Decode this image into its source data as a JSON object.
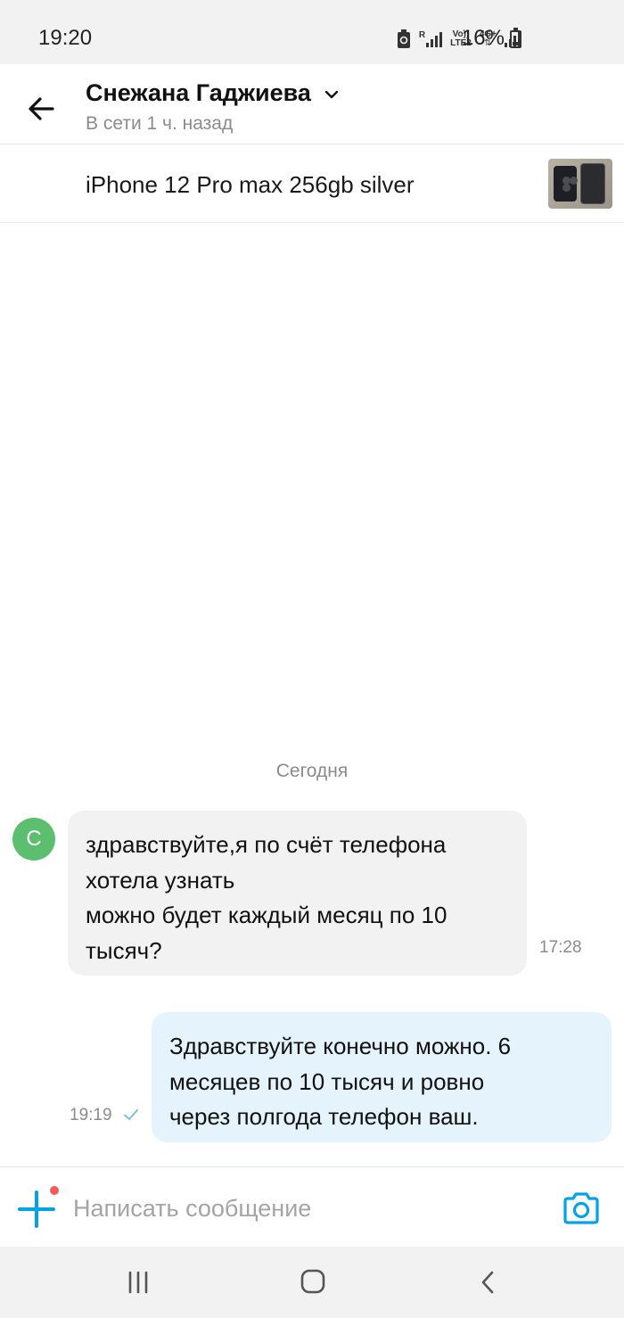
{
  "status_bar": {
    "time": "19:20",
    "roaming": "R",
    "volte_top": "Vo))",
    "volte_bottom": "LTE2",
    "network": "4G+",
    "battery": "16%"
  },
  "header": {
    "contact_name": "Снежана Гаджиева",
    "contact_status": "В сети 1 ч. назад"
  },
  "ad": {
    "title": "iPhone 12 Pro max 256gb silver"
  },
  "chat": {
    "date_separator": "Сегодня",
    "messages": [
      {
        "direction": "incoming",
        "avatar_letter": "С",
        "lines": [
          "здравствуйте,я по счёт телефона",
          "хотела узнать",
          "можно будет каждый месяц по 10",
          "тысяч?"
        ],
        "time": "17:28"
      },
      {
        "direction": "outgoing",
        "lines": [
          "Здравствуйте конечно можно. 6",
          "месяцев по 10 тысяч и ровно",
          "через полгода телефон ваш."
        ],
        "time": "19:19"
      }
    ]
  },
  "composer": {
    "placeholder": "Написать сообщение"
  },
  "colors": {
    "accent": "#00a3e8",
    "incoming_bubble": "#f2f2f2",
    "outgoing_bubble": "#e5f4fc",
    "avatar": "#5cbf6f",
    "notification_dot": "#f25b5b"
  },
  "icons": {
    "back": "arrow-left-icon",
    "name_chevron": "chevron-down-icon",
    "read_check": "check-icon",
    "attach": "plus-icon",
    "camera": "camera-icon"
  }
}
